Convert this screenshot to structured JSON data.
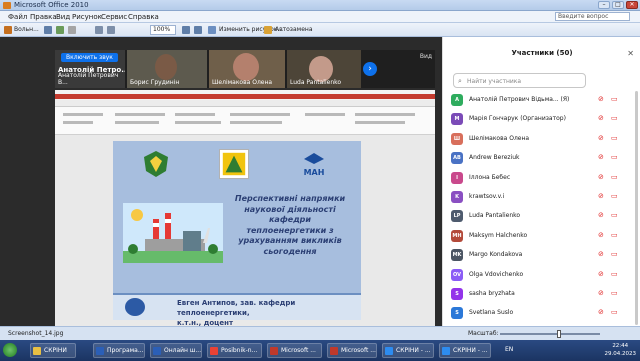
{
  "window": {
    "title": "Microsoft Office 2010"
  },
  "menu": [
    "Файл",
    "Правка",
    "Вид",
    "Рисунок",
    "Сервис",
    "Справка"
  ],
  "ask_placeholder": "Введите вопрос",
  "toolbar": {
    "zoom": "100%",
    "edit_label": "Изменить рисунок...",
    "autocorrect": "Автозамена",
    "open_label": "Вольн..."
  },
  "meeting": {
    "sound_button": "Включить звук",
    "view_label": "Вид",
    "tiles": [
      {
        "name": "Анатолій Петро...",
        "subname": "Анатолій Петрович В..."
      },
      {
        "name": "Борис Грудинін"
      },
      {
        "name": "Шелімакова Олена"
      },
      {
        "name": "Luda Pantalienko"
      }
    ]
  },
  "slide": {
    "title": "Перспективні напрямки наукової діяльності кафедри теплоенергетики з урахуванням викликів сьогодення",
    "author_line1": "Евген Антипов, зав. кафедри теплоенергетики,",
    "author_line2": "к.т.н., доцент",
    "logo3_label": "МАН"
  },
  "participants": {
    "title": "Участники (50)",
    "search_placeholder": "Найти участника",
    "list": [
      {
        "initial": "A",
        "color": "#2eac5e",
        "name": "Анатолій Петрович Відьма... (Я)"
      },
      {
        "initial": "M",
        "color": "#7b4bb7",
        "name": "Марія Гончарук (Организатор)"
      },
      {
        "initial": "Ш",
        "color": "#d86f5c",
        "name": "Шелімакова Олена"
      },
      {
        "initial": "AB",
        "color": "#4a72c4",
        "name": "Andrew Bereziuk"
      },
      {
        "initial": "I",
        "color": "#c9498c",
        "name": "Іллона Бебес"
      },
      {
        "initial": "K",
        "color": "#8a4fc2",
        "name": "krawtsov.v.i"
      },
      {
        "initial": "LP",
        "color": "#4e5b6e",
        "name": "Luda Pantalienko"
      },
      {
        "initial": "MH",
        "color": "#b34a3a",
        "name": "Maksym Halchenko"
      },
      {
        "initial": "MK",
        "color": "#4b5563",
        "name": "Margo Kondakova"
      },
      {
        "initial": "OV",
        "color": "#8b5cf6",
        "name": "Olga Vdovichenko"
      },
      {
        "initial": "S",
        "color": "#9333ea",
        "name": "sasha bryzhata"
      },
      {
        "initial": "S",
        "color": "#2b78d8",
        "name": "Svetlana Suslo"
      }
    ]
  },
  "status": {
    "file": "Screenshot_14.jpg",
    "scale": "Масштаб:"
  },
  "taskbar": {
    "items": [
      "СКРІНИ",
      "Програма...",
      "Онлайн ш...",
      "Posibnik-n...",
      "Microsoft ...",
      "Microsoft ...",
      "СКРІНИ - ...",
      "СКРІНИ - ..."
    ],
    "lang": "EN",
    "time": "22:44",
    "date": "29.04.2023"
  }
}
